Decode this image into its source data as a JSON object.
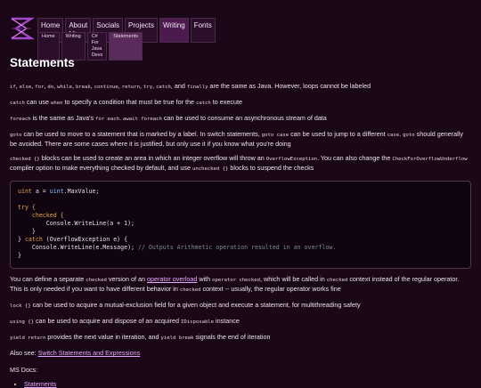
{
  "nav": {
    "items": [
      "Home",
      "About Me",
      "Socials",
      "Projects",
      "Writing",
      "Fonts"
    ],
    "active_index": 4
  },
  "breadcrumbs": [
    "Home",
    "Writing",
    "C# For Java Devs",
    "Statements"
  ],
  "page": {
    "title": "Statements",
    "p1": {
      "codes": [
        "if",
        "else",
        "for",
        "do",
        "while",
        "break",
        "continue",
        "return",
        "try",
        "catch",
        "finally"
      ],
      "and": "and",
      "text": "are the same as Java. However, loops cannot be labeled"
    },
    "p2": {
      "c1": "catch",
      "t1": "can use",
      "c2": "when",
      "t2": "to specify a condition that must be true for the",
      "c3": "catch",
      "t3": "to execute"
    },
    "p3": {
      "c1": "foreach",
      "t1": "is the same as Java's",
      "c2": "for each",
      "t2": ".",
      "c3": "await foreach",
      "t3": "can be used to consume an asynchronous stream of data"
    },
    "p4": {
      "c1": "goto",
      "t1": "can be used to move to a statement that is marked by a label. In switch statements,",
      "c2": "goto case",
      "t2": "can be used to jump to a different",
      "c3": "case",
      "t3": ".",
      "c4": "goto",
      "t4": "should generally be avoided. There are some cases where it is justified, but only use it if you know what you're doing"
    },
    "p5": {
      "c1": "checked {}",
      "t1": "blocks can be used to create an area in which an integer overflow will throw an",
      "c2": "OverflowException",
      "t2": ". You can also change the",
      "c3": "CheckForOverflowUnderflow",
      "t3": "compiler option to make everything checked by default, and use",
      "c4": "unchecked {}",
      "t4": "blocks to suspend the checks"
    },
    "code": {
      "l1": {
        "kw": "uint",
        "rest": " a = ",
        "ty": "uint",
        "rest2": ".MaxValue;"
      },
      "l3": "try {",
      "l4": "checked {",
      "l5": "Console.WriteLine(a + 1);",
      "l6": "}",
      "l7": {
        "pre": "} ",
        "kw": "catch",
        "rest": " (OverflowException e) {"
      },
      "l8": {
        "code": "Console.WriteLine(e.Message);",
        "comment": " // Outputs Arithmetic operation resulted in an overflow."
      },
      "l9": "}"
    },
    "p6": {
      "t1": "You can define a separate",
      "c1": "checked",
      "t2": "version of an",
      "l1": "operator overload",
      "t3": "with",
      "c2": "operator checked",
      "t4": ", which will be called in",
      "c3": "checked",
      "t5": "context instead of the regular operator. This is only needed if you want to have different behavior in",
      "c4": "checked",
      "t6": "context -- usually, the regular operator works fine"
    },
    "p7": {
      "c1": "lock {}",
      "t1": "can be used to acquire a mutual-exclusion field for a given object and execute a statement, for multithreading safety"
    },
    "p8": {
      "c1": "using {}",
      "t1": "can be used to acquire and dispose of an acquired",
      "c2": "IDisposable",
      "t2": "instance"
    },
    "p9": {
      "c1": "yield return",
      "t1": "provides the next value in iteration, and",
      "c2": "yield break",
      "t2": "signals the end of iteration"
    },
    "p10": {
      "t1": "Also see:",
      "l1": "Switch Statements and Expressions"
    },
    "ms_docs": {
      "label": "MS Docs:",
      "links": [
        "Statements"
      ]
    }
  }
}
